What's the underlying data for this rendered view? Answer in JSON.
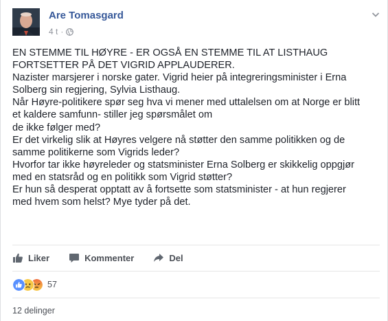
{
  "post": {
    "author": "Are Tomasgard",
    "time": "4 t",
    "separator": "·",
    "paragraphs": [
      "EN STEMME TIL HØYRE - ER OGSÅ EN STEMME TIL AT LISTHAUG",
      "FORTSETTER PÅ DET VIGRID APPLAUDERER.",
      "Nazister marsjerer i norske gater. Vigrid heier på integreringsminister i Erna",
      "Solberg sin regjering, Sylvia Listhaug.",
      "Når Høyre-politikere spør seg hva vi mener med uttalelsen om at Norge er blitt",
      "et kaldere samfunn- stiller jeg spørsmålet om",
      "de ikke følger med?",
      "Er det virkelig slik at Høyres velgere nå støtter den samme politikken og de",
      "samme politikerne som Vigrids leder?",
      "Hvorfor tar ikke høyreleder og statsminister Erna Solberg er skikkelig oppgjør",
      "med en statsråd og en politikk som Vigrid støtter?",
      "Er hun så desperat opptatt av å fortsette som statsminister - at hun regjerer",
      "med hvem som helst? Mye tyder på det."
    ]
  },
  "actions": {
    "like": "Liker",
    "comment": "Kommenter",
    "share": "Del"
  },
  "reactions": {
    "types": [
      "like-icon",
      "sad-icon",
      "angry-icon"
    ],
    "count": "57"
  },
  "shares": "12 delinger",
  "colors": {
    "author": "#365899",
    "like_blue": "#5890ff",
    "sad_yellow": "#f7c946",
    "angry_red": "#ef6c3c"
  }
}
